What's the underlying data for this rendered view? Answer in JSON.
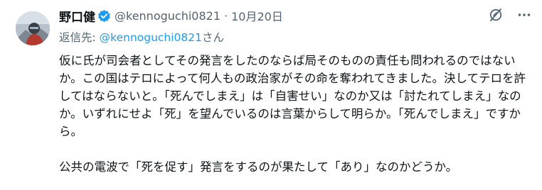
{
  "tweet": {
    "author": {
      "name": "野口健",
      "handle": "@kennoguchi0821",
      "separator": "·",
      "date": "10月20日"
    },
    "reply_to": {
      "prefix": "返信先: ",
      "mention": "@kennoguchi0821",
      "suffix": "さん"
    },
    "paragraphs": [
      "仮に氏が司会者としてその発言をしたのならば局そのものの責任も問われるのではないか。この国はテロによって何人もの政治家がその命を奪われてきました。決してテロを許してはならないと。「死んでしまえ」は「自害せい」なのか又は「討たれてしまえ」なのか。いずれにせよ「死」を望んでいるのは言葉からして明らか。「死んでしまえ」ですから。",
      "公共の電波で「死を促す」発言をするのが果たして「あり」なのかどうか。"
    ],
    "icons": {
      "verified": "verified-badge-icon",
      "grok": "grok-icon",
      "more": "more-horizontal-icon"
    },
    "colors": {
      "text": "#0f1419",
      "secondary": "#536471",
      "accent": "#1d9bf0"
    }
  }
}
